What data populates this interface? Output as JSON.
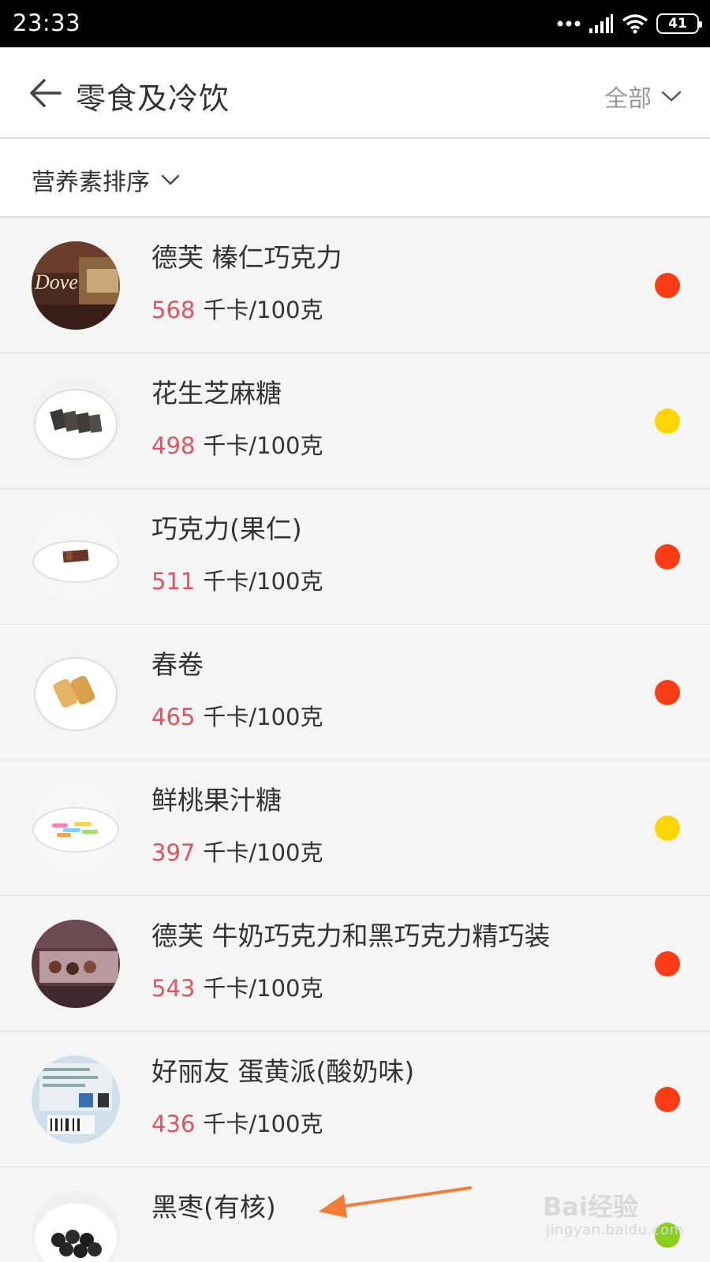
{
  "status_bar": {
    "time": "23:33",
    "battery": "41"
  },
  "header": {
    "title": "零食及冷饮",
    "filter_label": "全部"
  },
  "sort": {
    "label": "营养素排序"
  },
  "colors": {
    "red": "#ff3d14",
    "yellow": "#ffd500",
    "green": "#8ccf1e",
    "calorie": "#e8505b"
  },
  "items": [
    {
      "name": "德芙 榛仁巧克力",
      "calories": "568",
      "unit": "千卡/100克",
      "rating": "red",
      "image_icon": "chocolate-wrapper-icon"
    },
    {
      "name": "花生芝麻糖",
      "calories": "498",
      "unit": "千卡/100克",
      "rating": "yellow",
      "image_icon": "sesame-candy-plate-icon"
    },
    {
      "name": "巧克力(果仁)",
      "calories": "511",
      "unit": "千卡/100克",
      "rating": "red",
      "image_icon": "chocolate-plate-icon"
    },
    {
      "name": "春卷",
      "calories": "465",
      "unit": "千卡/100克",
      "rating": "red",
      "image_icon": "spring-roll-plate-icon"
    },
    {
      "name": "鲜桃果汁糖",
      "calories": "397",
      "unit": "千卡/100克",
      "rating": "yellow",
      "image_icon": "gummy-candy-plate-icon"
    },
    {
      "name": "德芙 牛奶巧克力和黑巧克力精巧装",
      "calories": "543",
      "unit": "千卡/100克",
      "rating": "red",
      "image_icon": "chocolate-box-icon"
    },
    {
      "name": "好丽友 蛋黄派(酸奶味)",
      "calories": "436",
      "unit": "千卡/100克",
      "rating": "red",
      "image_icon": "package-label-icon"
    },
    {
      "name": "黑枣(有核)",
      "calories": "",
      "unit": "",
      "rating": "green",
      "image_icon": "black-dates-bowl-icon"
    }
  ],
  "watermark": {
    "main": "Bai经验",
    "sub": "jingyan.baidu.com"
  }
}
